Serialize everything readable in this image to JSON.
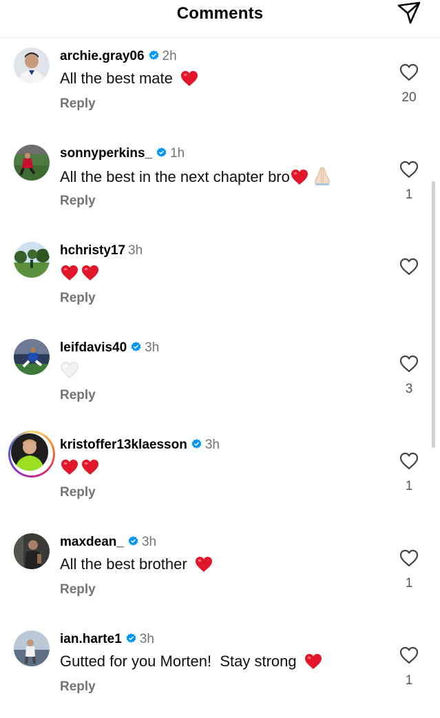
{
  "header": {
    "title": "Comments",
    "send_icon": "paper-plane-icon"
  },
  "colors": {
    "heart": "#e0162b",
    "verified": "#0095f6",
    "secondary_text": "#737373"
  },
  "comments": [
    {
      "username": "archie.gray06",
      "verified": true,
      "time": "2h",
      "text": "All the best mate",
      "emoji": [
        "red-heart"
      ],
      "reply": "Reply",
      "likes": "20"
    },
    {
      "username": "sonnyperkins_",
      "verified": true,
      "time": "1h",
      "text": "All the best in the next chapter bro",
      "emoji": [
        "red-heart",
        "folded-hands"
      ],
      "reply": "Reply",
      "likes": "1"
    },
    {
      "username": "hchristy17",
      "verified": false,
      "time": "3h",
      "text": "",
      "emoji": [
        "red-heart",
        "red-heart"
      ],
      "reply": "Reply",
      "likes": ""
    },
    {
      "username": "leifdavis40",
      "verified": true,
      "time": "3h",
      "text": "",
      "emoji": [
        "white-heart"
      ],
      "reply": "Reply",
      "likes": "3"
    },
    {
      "username": "kristoffer13klaesson",
      "verified": true,
      "time": "3h",
      "text": "",
      "emoji": [
        "red-heart",
        "red-heart"
      ],
      "reply": "Reply",
      "likes": "1",
      "story_ring": true
    },
    {
      "username": "maxdean_",
      "verified": true,
      "time": "3h",
      "text": "All the best brother",
      "emoji": [
        "red-heart"
      ],
      "reply": "Reply",
      "likes": "1"
    },
    {
      "username": "ian.harte1",
      "verified": true,
      "time": "3h",
      "text": "Gutted for you Morten!  Stay strong",
      "emoji": [
        "red-heart"
      ],
      "reply": "Reply",
      "likes": "1"
    }
  ]
}
